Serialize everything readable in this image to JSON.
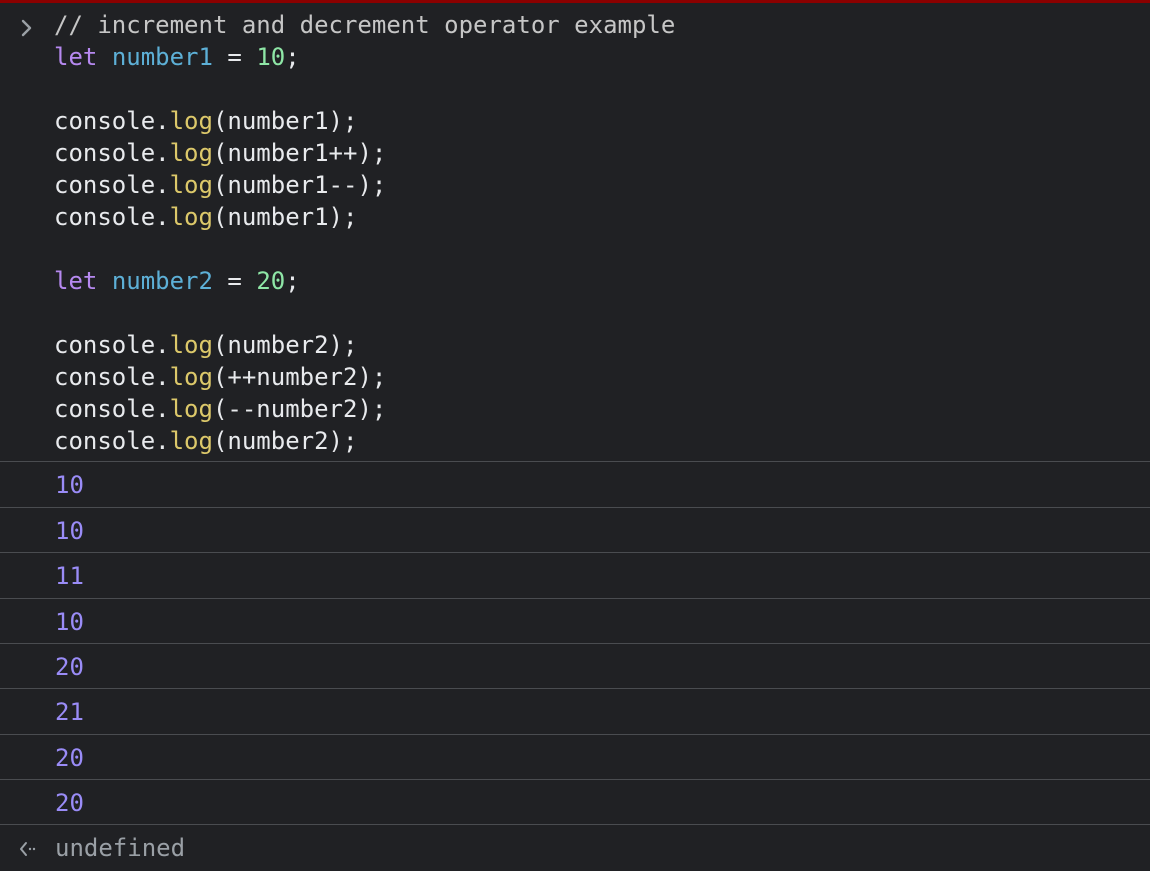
{
  "console": {
    "input_lines": [
      [
        {
          "t": "// increment and decrement operator example",
          "k": "comment"
        }
      ],
      [
        {
          "t": "let",
          "k": "keyword"
        },
        {
          "t": " ",
          "k": "plain"
        },
        {
          "t": "number1",
          "k": "var"
        },
        {
          "t": " = ",
          "k": "plain"
        },
        {
          "t": "10",
          "k": "num"
        },
        {
          "t": ";",
          "k": "plain"
        }
      ],
      [],
      [
        {
          "t": "console.",
          "k": "plain"
        },
        {
          "t": "log",
          "k": "func"
        },
        {
          "t": "(number1);",
          "k": "plain"
        }
      ],
      [
        {
          "t": "console.",
          "k": "plain"
        },
        {
          "t": "log",
          "k": "func"
        },
        {
          "t": "(number1++);",
          "k": "plain"
        }
      ],
      [
        {
          "t": "console.",
          "k": "plain"
        },
        {
          "t": "log",
          "k": "func"
        },
        {
          "t": "(number1--);",
          "k": "plain"
        }
      ],
      [
        {
          "t": "console.",
          "k": "plain"
        },
        {
          "t": "log",
          "k": "func"
        },
        {
          "t": "(number1);",
          "k": "plain"
        }
      ],
      [],
      [
        {
          "t": "let",
          "k": "keyword"
        },
        {
          "t": " ",
          "k": "plain"
        },
        {
          "t": "number2",
          "k": "var"
        },
        {
          "t": " = ",
          "k": "plain"
        },
        {
          "t": "20",
          "k": "num"
        },
        {
          "t": ";",
          "k": "plain"
        }
      ],
      [],
      [
        {
          "t": "console.",
          "k": "plain"
        },
        {
          "t": "log",
          "k": "func"
        },
        {
          "t": "(number2);",
          "k": "plain"
        }
      ],
      [
        {
          "t": "console.",
          "k": "plain"
        },
        {
          "t": "log",
          "k": "func"
        },
        {
          "t": "(++number2);",
          "k": "plain"
        }
      ],
      [
        {
          "t": "console.",
          "k": "plain"
        },
        {
          "t": "log",
          "k": "func"
        },
        {
          "t": "(--number2);",
          "k": "plain"
        }
      ],
      [
        {
          "t": "console.",
          "k": "plain"
        },
        {
          "t": "log",
          "k": "func"
        },
        {
          "t": "(number2);",
          "k": "plain"
        }
      ]
    ],
    "outputs": [
      "10",
      "10",
      "11",
      "10",
      "20",
      "21",
      "20",
      "20"
    ],
    "result": "undefined"
  },
  "icons": {
    "prompt": "chevron-right-icon",
    "result": "return-arrow-icon"
  },
  "colors": {
    "background": "#202124",
    "output_number": "#9a8cf7",
    "keyword": "#b689f0",
    "variable": "#5db0d7",
    "number_literal": "#8ee6a6",
    "function": "#dcc86a",
    "result_text": "#9aa0a6"
  }
}
